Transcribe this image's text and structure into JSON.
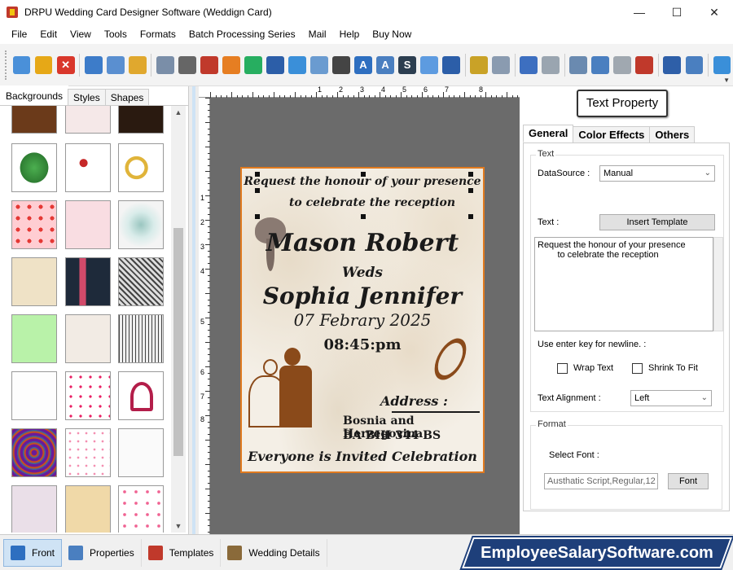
{
  "window": {
    "title": "DRPU Wedding Card Designer Software (Weddign Card)",
    "minimize": "—",
    "maximize": "☐",
    "close": "✕"
  },
  "menu": [
    "File",
    "Edit",
    "View",
    "Tools",
    "Formats",
    "Batch Processing Series",
    "Mail",
    "Help",
    "Buy Now"
  ],
  "left_tabs": [
    "Backgrounds",
    "Styles",
    "Shapes"
  ],
  "ruler": {
    "h": [
      "1",
      "2",
      "3",
      "4",
      "5",
      "6",
      "7",
      "8"
    ],
    "v": [
      "1",
      "2",
      "3",
      "4",
      "5",
      "6",
      "7",
      "8"
    ]
  },
  "card": {
    "line1": "Request the honour of your presence",
    "line2": "to celebrate the reception",
    "groom": "Mason Robert",
    "weds": "Weds",
    "bride": "Sophia Jennifer",
    "date": "07 Febrary 2025",
    "time": "08:45:pm",
    "address_label": "Address :",
    "address1": "Bosnia and Herzegovina",
    "address2": "BA BIH 344 BS",
    "footer": "Everyone is Invited Celebration"
  },
  "right": {
    "header": "Text Property",
    "tabs": [
      "General",
      "Color Effects",
      "Others"
    ],
    "text_group": "Text",
    "datasource_label": "DataSource :",
    "datasource_value": "Manual",
    "text_label": "Text :",
    "insert_template": "Insert Template",
    "text_value": "Request the honour of your presence\n        to celebrate the reception",
    "newline_hint": "Use enter key for newline. :",
    "wrap_text": "Wrap Text",
    "shrink_to_fit": "Shrink To Fit",
    "alignment_label": "Text Alignment :",
    "alignment_value": "Left",
    "format_group": "Format",
    "select_font_label": "Select Font :",
    "font_value": "Austhatic Script,Regular,12",
    "font_button": "Font"
  },
  "statusbar": {
    "front": "Front",
    "properties": "Properties",
    "templates": "Templates",
    "wedding_details": "Wedding Details",
    "brand": "EmployeeSalarySoftware.com"
  },
  "colors": {
    "card_border": "#e07a1f",
    "brand_bg": "#1e3f7a",
    "canvas_bg": "#6b6b6b"
  }
}
